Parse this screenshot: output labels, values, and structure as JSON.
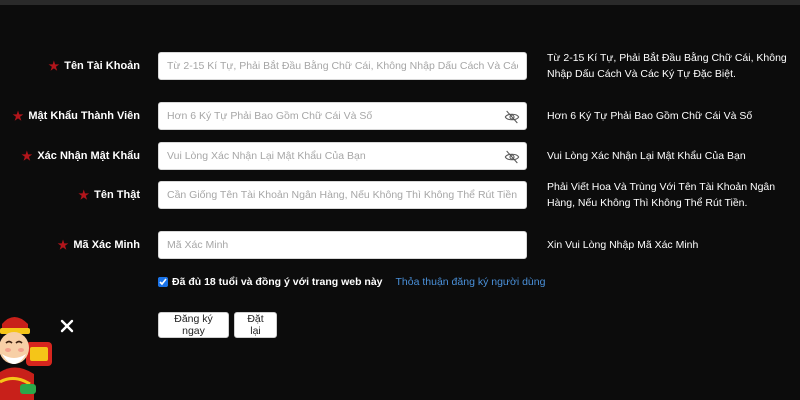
{
  "form": {
    "fields": [
      {
        "label": "Tên Tài Khoản",
        "placeholder": "Từ 2-15 Kí Tự, Phải Bắt Đầu Bằng Chữ Cái, Không Nhập Dấu Cách Và Các Ký Tự Đặc Biệt",
        "hint": "Từ 2-15 Kí Tự, Phải Bắt Đầu Bằng Chữ Cái, Không Nhập Dấu Cách Và Các Ký Tự Đặc Biệt.",
        "icon": "none"
      },
      {
        "label": "Mật Khẩu Thành Viên",
        "placeholder": "Hơn 6 Ký Tự Phải Bao Gồm Chữ Cái Và Số",
        "hint": "Hơn 6 Ký Tự Phải Bao Gồm Chữ Cái Và Số",
        "icon": "eye-off-icon"
      },
      {
        "label": "Xác Nhận Mật Khẩu",
        "placeholder": "Vui Lòng Xác Nhận Lại Mật Khẩu Của Bạn",
        "hint": "Vui Lòng Xác Nhận Lại Mật Khẩu Của Bạn",
        "icon": "eye-off-icon"
      },
      {
        "label": "Tên Thật",
        "placeholder": "Cần Giống Tên Tài Khoản Ngân Hàng, Nếu Không Thì Không Thể Rút Tiền",
        "hint": "Phải Viết Hoa Và Trùng Với Tên Tài Khoản Ngân Hàng, Nếu Không Thì Không Thể Rút Tiền.",
        "icon": "none"
      },
      {
        "label": "Mã Xác Minh",
        "placeholder": "Mã Xác Minh",
        "hint": "Xin Vui Lòng Nhập Mã Xác Minh",
        "icon": "none"
      }
    ],
    "agreement": {
      "checked": true,
      "text": "Đã đủ 18 tuổi và đồng ý với trang web này",
      "link": "Thỏa thuận đăng ký người dùng"
    },
    "buttons": {
      "register": "Đăng ký ngay",
      "reset": "Đặt lại"
    }
  },
  "colors": {
    "background": "#0c0c0c",
    "required_star": "#b3151b",
    "link": "#4a90d9",
    "text": "#ffffff"
  },
  "icons": {
    "required": "star-icon",
    "close": "close-icon",
    "mascot": "mascot-icon"
  }
}
